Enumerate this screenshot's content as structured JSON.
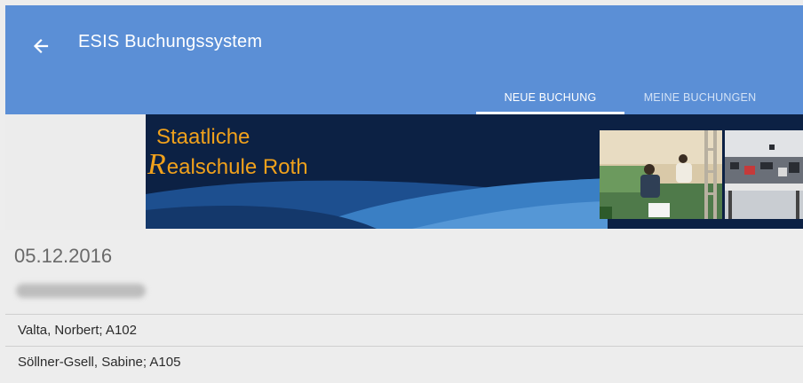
{
  "appbar": {
    "title": "ESIS Buchungssystem",
    "back_icon": "arrow-left-icon",
    "color": "#5b8fd6"
  },
  "tabs": [
    {
      "label": "NEUE BUCHUNG",
      "active": true
    },
    {
      "label": "MEINE BUCHUNGEN",
      "active": false
    }
  ],
  "banner": {
    "line1": "Staatliche",
    "line2_initial": "R",
    "line2_rest": "ealschule Roth",
    "text_color": "#f0a11c"
  },
  "booking": {
    "date": "05.12.2016"
  },
  "list": [
    {
      "label": "Valta, Norbert; A102"
    },
    {
      "label": "Söllner-Gsell, Sabine; A105"
    }
  ]
}
